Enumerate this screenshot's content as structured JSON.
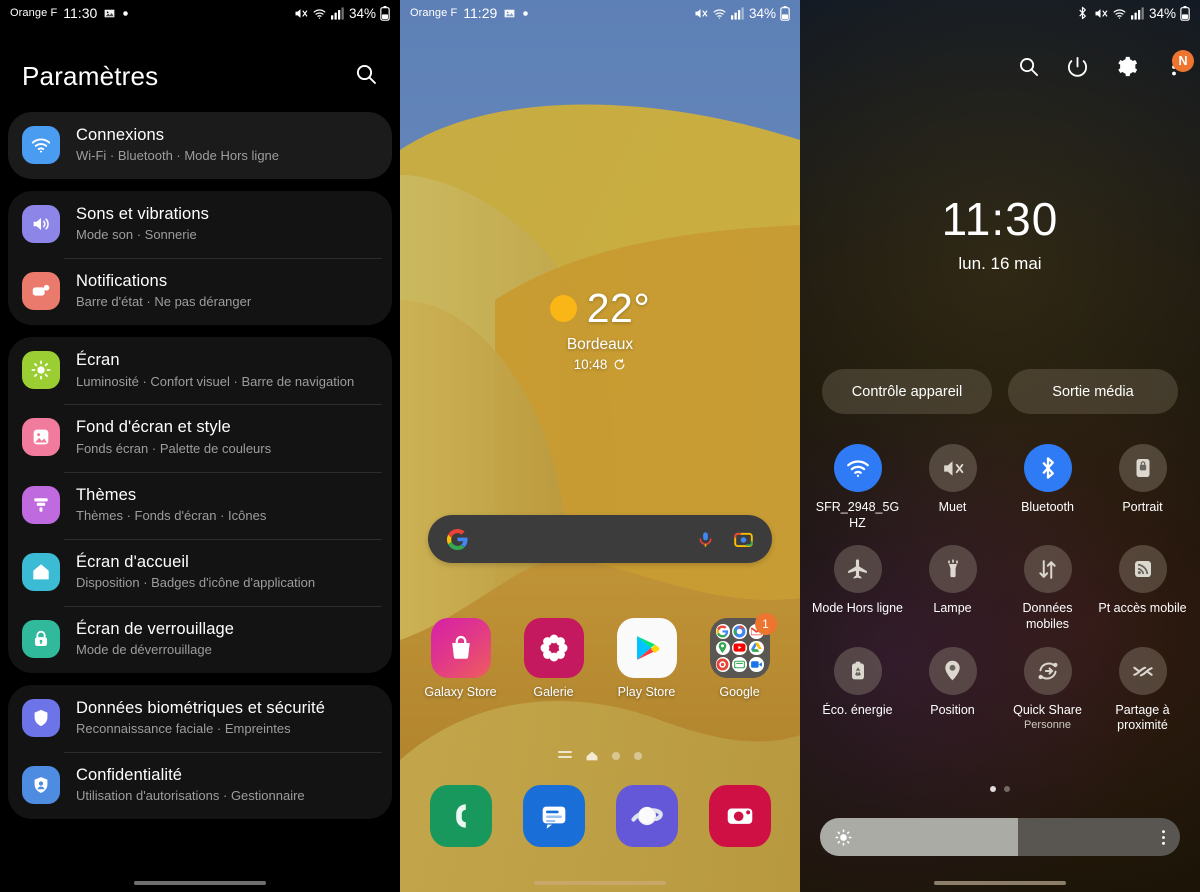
{
  "settings_screen": {
    "status_bar": {
      "carrier": "Orange F",
      "time": "11:30",
      "battery": "34%"
    },
    "title": "Paramètres",
    "search_icon": "search-icon",
    "groups": [
      {
        "selected": true,
        "items": [
          {
            "icon": "wifi-icon",
            "color": "#4a9cf0",
            "title": "Connexions",
            "subtitle": "Wi-Fi  ·  Bluetooth  ·  Mode Hors ligne"
          }
        ]
      },
      {
        "selected": false,
        "items": [
          {
            "icon": "sound-icon",
            "color": "#8d85e8",
            "title": "Sons et vibrations",
            "subtitle": "Mode son  ·  Sonnerie"
          },
          {
            "icon": "notification-icon",
            "color": "#ea7b6c",
            "title": "Notifications",
            "subtitle": "Barre d'état  ·  Ne pas déranger"
          }
        ]
      },
      {
        "selected": false,
        "items": [
          {
            "icon": "brightness-icon",
            "color": "#9ace32",
            "title": "Écran",
            "subtitle": "Luminosité  ·  Confort visuel  ·  Barre de navigation"
          },
          {
            "icon": "wallpaper-icon",
            "color": "#f07b9c",
            "title": "Fond d'écran et style",
            "subtitle": "Fonds écran  ·  Palette de couleurs"
          },
          {
            "icon": "theme-icon",
            "color": "#c06ae0",
            "title": "Thèmes",
            "subtitle": "Thèmes  ·  Fonds d'écran  ·  Icônes"
          },
          {
            "icon": "home-icon",
            "color": "#3bbcd4",
            "title": "Écran d'accueil",
            "subtitle": "Disposition  ·  Badges d'icône d'application"
          },
          {
            "icon": "lock-icon",
            "color": "#30b99a",
            "title": "Écran de verrouillage",
            "subtitle": "Mode de déverrouillage"
          }
        ]
      },
      {
        "selected": false,
        "items": [
          {
            "icon": "shield-icon",
            "color": "#6d74e8",
            "title": "Données biométriques et sécurité",
            "subtitle": "Reconnaissance faciale  ·  Empreintes"
          },
          {
            "icon": "privacy-icon",
            "color": "#4d8ce0",
            "title": "Confidentialité",
            "subtitle": "Utilisation d'autorisations  ·  Gestionnaire"
          }
        ]
      }
    ]
  },
  "home_screen": {
    "status_bar": {
      "carrier": "Orange F",
      "time": "11:29",
      "battery": "34%"
    },
    "weather": {
      "temperature": "22°",
      "city": "Bordeaux",
      "updated": "10:48",
      "condition_icon": "sunny-icon"
    },
    "search_bar": {
      "logo": "google-logo-icon",
      "mic": "microphone-icon",
      "lens": "google-lens-icon"
    },
    "apps": [
      {
        "name": "Galaxy Store",
        "icon": "galaxy-store-icon"
      },
      {
        "name": "Galerie",
        "icon": "gallery-icon"
      },
      {
        "name": "Play Store",
        "icon": "play-store-icon"
      },
      {
        "name": "Google",
        "icon": "google-folder-icon",
        "badge": "1"
      }
    ],
    "page_indicator": {
      "pages": 4,
      "active": 1
    },
    "dock": [
      {
        "name": "Téléphone",
        "icon": "phone-icon"
      },
      {
        "name": "Messages",
        "icon": "messages-icon"
      },
      {
        "name": "Internet",
        "icon": "samsung-internet-icon"
      },
      {
        "name": "Appareil photo",
        "icon": "camera-icon"
      }
    ]
  },
  "quick_settings": {
    "status_bar": {
      "battery": "34%"
    },
    "tools": [
      "search-icon",
      "power-icon",
      "gear-icon",
      "more-icon"
    ],
    "more_badge": "N",
    "clock": {
      "time": "11:30",
      "date": "lun. 16 mai"
    },
    "pills": [
      {
        "label": "Contrôle appareil"
      },
      {
        "label": "Sortie média"
      }
    ],
    "tiles": [
      {
        "label": "SFR_2948_5G HZ",
        "icon": "wifi-icon",
        "active": true
      },
      {
        "label": "Muet",
        "icon": "mute-icon",
        "active": false
      },
      {
        "label": "Bluetooth",
        "icon": "bluetooth-icon",
        "active": true
      },
      {
        "label": "Portrait",
        "icon": "rotation-lock-icon",
        "active": false
      },
      {
        "label": "Mode Hors ligne",
        "icon": "airplane-icon",
        "active": false
      },
      {
        "label": "Lampe",
        "icon": "flashlight-icon",
        "active": false
      },
      {
        "label": "Données mobiles",
        "icon": "mobile-data-icon",
        "active": false
      },
      {
        "label": "Pt accès mobile",
        "icon": "hotspot-icon",
        "active": false
      },
      {
        "label": "Éco. énergie",
        "icon": "power-saving-icon",
        "active": false
      },
      {
        "label": "Position",
        "icon": "location-icon",
        "active": false
      },
      {
        "label": "Quick Share",
        "sublabel": "Personne",
        "icon": "quick-share-icon",
        "active": false
      },
      {
        "label": "Partage à proximité",
        "icon": "nearby-share-icon",
        "active": false
      }
    ],
    "page_dots": {
      "pages": 2,
      "active": 0
    },
    "brightness": {
      "value": 55,
      "icon": "brightness-icon",
      "menu": "more-vertical-icon"
    },
    "accent_color": "#2f7bf6"
  }
}
